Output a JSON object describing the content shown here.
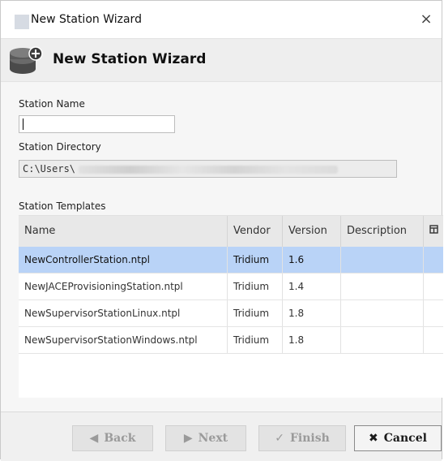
{
  "window": {
    "title": "New Station Wizard",
    "close_glyph": "×"
  },
  "header": {
    "title": "New Station Wizard",
    "icon": "station-database-icon"
  },
  "form": {
    "station_name_label": "Station Name",
    "station_name_value": "",
    "station_directory_label": "Station Directory",
    "station_directory_value": "C:\\Users\\"
  },
  "templates": {
    "label": "Station Templates",
    "columns": [
      "Name",
      "Vendor",
      "Version",
      "Description"
    ],
    "column_chooser_icon": "column-chooser-icon",
    "rows": [
      {
        "name": "NewControllerStation.ntpl",
        "vendor": "Tridium",
        "version": "1.6",
        "description": "",
        "selected": true
      },
      {
        "name": "NewJACEProvisioningStation.ntpl",
        "vendor": "Tridium",
        "version": "1.4",
        "description": "",
        "selected": false
      },
      {
        "name": "NewSupervisorStationLinux.ntpl",
        "vendor": "Tridium",
        "version": "1.8",
        "description": "",
        "selected": false
      },
      {
        "name": "NewSupervisorStationWindows.ntpl",
        "vendor": "Tridium",
        "version": "1.8",
        "description": "",
        "selected": false
      }
    ]
  },
  "buttons": {
    "back": {
      "label": "Back",
      "icon": "◀",
      "enabled": false
    },
    "next": {
      "label": "Next",
      "icon": "▶",
      "enabled": false
    },
    "finish": {
      "label": "Finish",
      "icon": "✓",
      "enabled": false
    },
    "cancel": {
      "label": "Cancel",
      "icon": "✖",
      "enabled": true
    }
  },
  "colors": {
    "selected_row": "#b9d3f7",
    "header_band": "#eeeeee"
  }
}
